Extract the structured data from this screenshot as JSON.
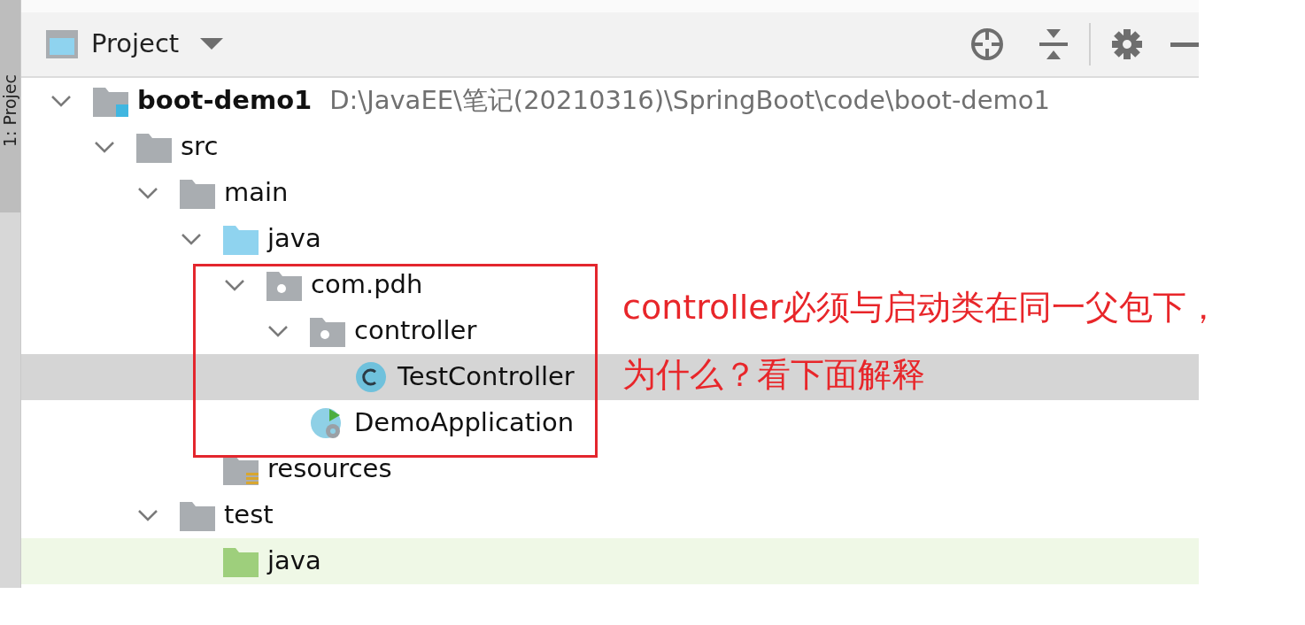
{
  "side_tab": {
    "label": "1: Projec"
  },
  "header": {
    "title": "Project"
  },
  "tree": [
    {
      "label": "boot-demo1",
      "path": "D:\\JavaEE\\笔记(20210316)\\SpringBoot\\code\\boot-demo1",
      "kind": "module",
      "expanded": true,
      "selected": false,
      "children": [
        {
          "label": "src",
          "kind": "folder",
          "expanded": true,
          "selected": false,
          "children": [
            {
              "label": "main",
              "kind": "folder",
              "expanded": true,
              "selected": false,
              "children": [
                {
                  "label": "java",
                  "kind": "source-root",
                  "expanded": true,
                  "selected": false,
                  "children": [
                    {
                      "label": "com.pdh",
                      "kind": "package",
                      "expanded": true,
                      "selected": false,
                      "children": [
                        {
                          "label": "controller",
                          "kind": "package",
                          "expanded": true,
                          "selected": false,
                          "children": [
                            {
                              "label": "TestController",
                              "kind": "class",
                              "selected": true
                            }
                          ]
                        },
                        {
                          "label": "DemoApplication",
                          "kind": "spring-class",
                          "selected": false
                        }
                      ]
                    }
                  ]
                },
                {
                  "label": "resources",
                  "kind": "resources-root",
                  "selected": false
                }
              ]
            },
            {
              "label": "test",
              "kind": "folder",
              "expanded": true,
              "selected": false,
              "children": [
                {
                  "label": "java",
                  "kind": "test-root",
                  "selected": false
                }
              ]
            }
          ]
        }
      ]
    }
  ],
  "annotation": {
    "lines": [
      "controller必须与启动类在同一父包下，",
      "为什么？看下面解释"
    ]
  }
}
